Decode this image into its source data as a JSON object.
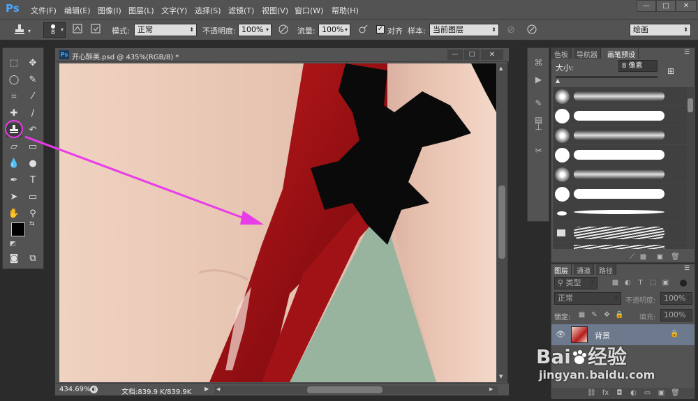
{
  "app": {
    "logo": "Ps",
    "menu": [
      "文件(F)",
      "编辑(E)",
      "图像(I)",
      "图层(L)",
      "文字(Y)",
      "选择(S)",
      "滤镜(T)",
      "视图(V)",
      "窗口(W)",
      "帮助(H)"
    ],
    "window_buttons": [
      "—",
      "□",
      "✕"
    ]
  },
  "options_bar": {
    "brush_size": "8",
    "mode_label": "模式:",
    "mode_value": "正常",
    "opacity_label": "不透明度:",
    "opacity_value": "100%",
    "flow_label": "流量:",
    "flow_value": "100%",
    "aligned_label": "对齐",
    "aligned_checked": true,
    "sample_label": "样本:",
    "sample_value": "当前图层",
    "workspace_value": "绘画"
  },
  "document": {
    "title": "开心醉美.psd @ 435%(RGB/8) *",
    "title_icon": "Ps",
    "zoom": "434.69%",
    "doc_info": "文档:839.9 K/839.9K",
    "window_buttons": [
      "—",
      "□",
      "✕"
    ]
  },
  "brush_panel": {
    "tabs": [
      "色板",
      "导航器",
      "画笔预设"
    ],
    "active_tab": "画笔预设",
    "size_label": "大小:",
    "size_value": "8 像素"
  },
  "layers_panel": {
    "tabs": [
      "图层",
      "通道",
      "路径"
    ],
    "active_tab": "图层",
    "filter_label": "类型",
    "blend_mode": "正常",
    "opacity_label": "不透明度:",
    "opacity_value": "100%",
    "lock_label": "锁定:",
    "fill_label": "填充:",
    "fill_value": "100%",
    "layer_name": "背景"
  },
  "watermark": {
    "brand": "Bai",
    "brand_tail": "经验",
    "url": "jingyan.baidu.com"
  },
  "colors": {
    "ui_bg": "#535353",
    "dark_bg": "#2b2b2b",
    "accent_magenta": "#e83ce8",
    "ps_blue": "#4aa7ff"
  }
}
